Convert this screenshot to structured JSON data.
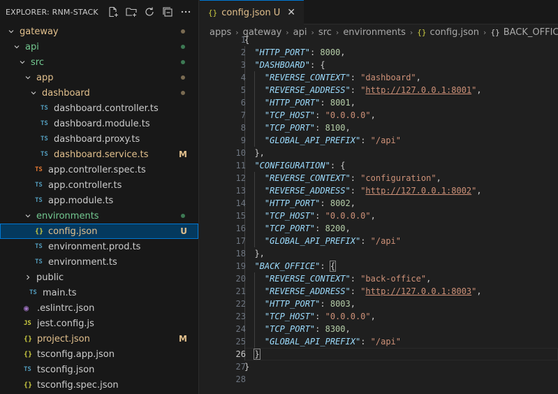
{
  "sidebar": {
    "title": "EXPLORER: RNM-STACK",
    "actions": [
      {
        "name": "new-file-icon"
      },
      {
        "name": "new-folder-icon"
      },
      {
        "name": "refresh-icon"
      },
      {
        "name": "collapse-all-icon"
      },
      {
        "name": "more-actions-icon"
      }
    ],
    "tree": [
      {
        "label": "gateway",
        "depth": 0,
        "kind": "folder",
        "open": true,
        "color": "yellow",
        "deco": "dot-yellow"
      },
      {
        "label": "api",
        "depth": 1,
        "kind": "folder",
        "open": true,
        "color": "green",
        "deco": "dot-green"
      },
      {
        "label": "src",
        "depth": 2,
        "kind": "folder",
        "open": true,
        "color": "green",
        "deco": "dot-green"
      },
      {
        "label": "app",
        "depth": 3,
        "kind": "folder",
        "open": true,
        "color": "yellow",
        "deco": "dot-yellow"
      },
      {
        "label": "dashboard",
        "depth": 4,
        "kind": "folder",
        "open": true,
        "color": "yellow",
        "deco": "dot-yellow"
      },
      {
        "label": "dashboard.controller.ts",
        "depth": 5,
        "kind": "file",
        "icon": "ts",
        "icon_text": "TS",
        "color": "plain"
      },
      {
        "label": "dashboard.module.ts",
        "depth": 5,
        "kind": "file",
        "icon": "ts",
        "icon_text": "TS",
        "color": "plain"
      },
      {
        "label": "dashboard.proxy.ts",
        "depth": 5,
        "kind": "file",
        "icon": "ts",
        "icon_text": "TS",
        "color": "plain"
      },
      {
        "label": "dashboard.service.ts",
        "depth": 5,
        "kind": "file",
        "icon": "ts",
        "icon_text": "TS",
        "color": "yellow",
        "badge": "M"
      },
      {
        "label": "app.controller.spec.ts",
        "depth": 4,
        "kind": "file",
        "icon": "tsspec",
        "icon_text": "TS",
        "color": "plain"
      },
      {
        "label": "app.controller.ts",
        "depth": 4,
        "kind": "file",
        "icon": "ts",
        "icon_text": "TS",
        "color": "plain"
      },
      {
        "label": "app.module.ts",
        "depth": 4,
        "kind": "file",
        "icon": "ts",
        "icon_text": "TS",
        "color": "plain"
      },
      {
        "label": "environments",
        "depth": 3,
        "kind": "folder",
        "open": true,
        "color": "green",
        "deco": "dot-green"
      },
      {
        "label": "config.json",
        "depth": 4,
        "kind": "file",
        "icon": "json",
        "icon_text": "{}",
        "color": "yellow",
        "badge": "U",
        "selected": true
      },
      {
        "label": "environment.prod.ts",
        "depth": 4,
        "kind": "file",
        "icon": "ts",
        "icon_text": "TS",
        "color": "plain"
      },
      {
        "label": "environment.ts",
        "depth": 4,
        "kind": "file",
        "icon": "ts",
        "icon_text": "TS",
        "color": "plain"
      },
      {
        "label": "public",
        "depth": 3,
        "kind": "folder",
        "open": false,
        "color": "plain"
      },
      {
        "label": "main.ts",
        "depth": 3,
        "kind": "file",
        "icon": "ts",
        "icon_text": "TS",
        "color": "plain"
      },
      {
        "label": ".eslintrc.json",
        "depth": 2,
        "kind": "file",
        "icon": "eslint",
        "icon_text": "◉",
        "color": "plain"
      },
      {
        "label": "jest.config.js",
        "depth": 2,
        "kind": "file",
        "icon": "js",
        "icon_text": "JS",
        "color": "plain"
      },
      {
        "label": "project.json",
        "depth": 2,
        "kind": "file",
        "icon": "json",
        "icon_text": "{}",
        "color": "yellow",
        "badge": "M"
      },
      {
        "label": "tsconfig.app.json",
        "depth": 2,
        "kind": "file",
        "icon": "json",
        "icon_text": "{}",
        "color": "plain"
      },
      {
        "label": "tsconfig.json",
        "depth": 2,
        "kind": "file",
        "icon": "tsconfig",
        "icon_text": "TS",
        "color": "plain"
      },
      {
        "label": "tsconfig.spec.json",
        "depth": 2,
        "kind": "file",
        "icon": "json",
        "icon_text": "{}",
        "color": "plain"
      }
    ]
  },
  "editor": {
    "tab": {
      "icon_text": "{}",
      "label": "config.json",
      "status": "U",
      "close": "✕"
    },
    "breadcrumb": [
      "apps",
      "gateway",
      "api",
      "src",
      "environments",
      "config.json",
      "BACK_OFFICE"
    ],
    "breadcrumb_icons": {
      "json": "{}",
      "symbol": "{}"
    },
    "current_line": 26,
    "lines": [
      {
        "n": 1,
        "indent": 0,
        "tokens": [
          [
            "p",
            "{"
          ]
        ]
      },
      {
        "n": 2,
        "indent": 1,
        "tokens": [
          [
            "k",
            "\"HTTP_PORT\""
          ],
          [
            "p",
            ": "
          ],
          [
            "n",
            "8000"
          ],
          [
            "p",
            ","
          ]
        ]
      },
      {
        "n": 3,
        "indent": 1,
        "tokens": [
          [
            "k",
            "\"DASHBOARD\""
          ],
          [
            "p",
            ": {"
          ]
        ]
      },
      {
        "n": 4,
        "indent": 2,
        "tokens": [
          [
            "k",
            "\"REVERSE_CONTEXT\""
          ],
          [
            "p",
            ": "
          ],
          [
            "s",
            "\"dashboard\""
          ],
          [
            "p",
            ","
          ]
        ]
      },
      {
        "n": 5,
        "indent": 2,
        "tokens": [
          [
            "k",
            "\"REVERSE_ADDRESS\""
          ],
          [
            "p",
            ": "
          ],
          [
            "s",
            "\""
          ],
          [
            "u",
            "http://127.0.0.1:8001"
          ],
          [
            "s",
            "\""
          ],
          [
            "p",
            ","
          ]
        ]
      },
      {
        "n": 6,
        "indent": 2,
        "tokens": [
          [
            "k",
            "\"HTTP_PORT\""
          ],
          [
            "p",
            ": "
          ],
          [
            "n",
            "8001"
          ],
          [
            "p",
            ","
          ]
        ]
      },
      {
        "n": 7,
        "indent": 2,
        "tokens": [
          [
            "k",
            "\"TCP_HOST\""
          ],
          [
            "p",
            ": "
          ],
          [
            "s",
            "\"0.0.0.0\""
          ],
          [
            "p",
            ","
          ]
        ]
      },
      {
        "n": 8,
        "indent": 2,
        "tokens": [
          [
            "k",
            "\"TCP_PORT\""
          ],
          [
            "p",
            ": "
          ],
          [
            "n",
            "8100"
          ],
          [
            "p",
            ","
          ]
        ]
      },
      {
        "n": 9,
        "indent": 2,
        "tokens": [
          [
            "k",
            "\"GLOBAL_API_PREFIX\""
          ],
          [
            "p",
            ": "
          ],
          [
            "s",
            "\"/api\""
          ]
        ]
      },
      {
        "n": 10,
        "indent": 1,
        "tokens": [
          [
            "p",
            "},"
          ]
        ]
      },
      {
        "n": 11,
        "indent": 1,
        "tokens": [
          [
            "k",
            "\"CONFIGURATION\""
          ],
          [
            "p",
            ": {"
          ]
        ]
      },
      {
        "n": 12,
        "indent": 2,
        "tokens": [
          [
            "k",
            "\"REVERSE_CONTEXT\""
          ],
          [
            "p",
            ": "
          ],
          [
            "s",
            "\"configuration\""
          ],
          [
            "p",
            ","
          ]
        ]
      },
      {
        "n": 13,
        "indent": 2,
        "tokens": [
          [
            "k",
            "\"REVERSE_ADDRESS\""
          ],
          [
            "p",
            ": "
          ],
          [
            "s",
            "\""
          ],
          [
            "u",
            "http://127.0.0.1:8002"
          ],
          [
            "s",
            "\""
          ],
          [
            "p",
            ","
          ]
        ]
      },
      {
        "n": 14,
        "indent": 2,
        "tokens": [
          [
            "k",
            "\"HTTP_PORT\""
          ],
          [
            "p",
            ": "
          ],
          [
            "n",
            "8002"
          ],
          [
            "p",
            ","
          ]
        ]
      },
      {
        "n": 15,
        "indent": 2,
        "tokens": [
          [
            "k",
            "\"TCP_HOST\""
          ],
          [
            "p",
            ": "
          ],
          [
            "s",
            "\"0.0.0.0\""
          ],
          [
            "p",
            ","
          ]
        ]
      },
      {
        "n": 16,
        "indent": 2,
        "tokens": [
          [
            "k",
            "\"TCP_PORT\""
          ],
          [
            "p",
            ": "
          ],
          [
            "n",
            "8200"
          ],
          [
            "p",
            ","
          ]
        ]
      },
      {
        "n": 17,
        "indent": 2,
        "tokens": [
          [
            "k",
            "\"GLOBAL_API_PREFIX\""
          ],
          [
            "p",
            ": "
          ],
          [
            "s",
            "\"/api\""
          ]
        ]
      },
      {
        "n": 18,
        "indent": 1,
        "tokens": [
          [
            "p",
            "},"
          ]
        ]
      },
      {
        "n": 19,
        "indent": 1,
        "tokens": [
          [
            "k",
            "\"BACK_OFFICE\""
          ],
          [
            "p",
            ": "
          ],
          [
            "bm",
            "{"
          ]
        ]
      },
      {
        "n": 20,
        "indent": 2,
        "tokens": [
          [
            "k",
            "\"REVERSE_CONTEXT\""
          ],
          [
            "p",
            ": "
          ],
          [
            "s",
            "\"back-office\""
          ],
          [
            "p",
            ","
          ]
        ]
      },
      {
        "n": 21,
        "indent": 2,
        "tokens": [
          [
            "k",
            "\"REVERSE_ADDRESS\""
          ],
          [
            "p",
            ": "
          ],
          [
            "s",
            "\""
          ],
          [
            "u",
            "http://127.0.0.1:8003"
          ],
          [
            "s",
            "\""
          ],
          [
            "p",
            ","
          ]
        ]
      },
      {
        "n": 22,
        "indent": 2,
        "tokens": [
          [
            "k",
            "\"HTTP_PORT\""
          ],
          [
            "p",
            ": "
          ],
          [
            "n",
            "8003"
          ],
          [
            "p",
            ","
          ]
        ]
      },
      {
        "n": 23,
        "indent": 2,
        "tokens": [
          [
            "k",
            "\"TCP_HOST\""
          ],
          [
            "p",
            ": "
          ],
          [
            "s",
            "\"0.0.0.0\""
          ],
          [
            "p",
            ","
          ]
        ]
      },
      {
        "n": 24,
        "indent": 2,
        "tokens": [
          [
            "k",
            "\"TCP_PORT\""
          ],
          [
            "p",
            ": "
          ],
          [
            "n",
            "8300"
          ],
          [
            "p",
            ","
          ]
        ]
      },
      {
        "n": 25,
        "indent": 2,
        "tokens": [
          [
            "k",
            "\"GLOBAL_API_PREFIX\""
          ],
          [
            "p",
            ": "
          ],
          [
            "s",
            "\"/api\""
          ]
        ]
      },
      {
        "n": 26,
        "indent": 1,
        "tokens": [
          [
            "bm",
            "}"
          ]
        ]
      },
      {
        "n": 27,
        "indent": 0,
        "tokens": [
          [
            "p",
            "}"
          ]
        ]
      },
      {
        "n": 28,
        "indent": 0,
        "tokens": []
      }
    ]
  }
}
